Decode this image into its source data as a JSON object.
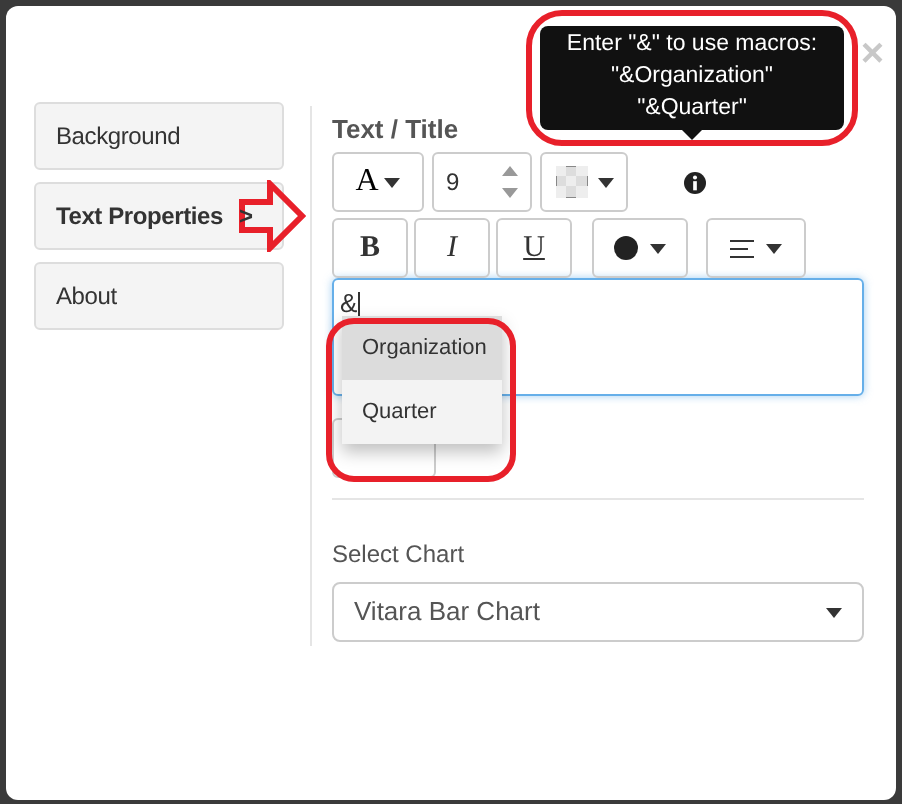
{
  "dialog": {
    "close": "×"
  },
  "sidebar": {
    "items": [
      {
        "label": "Background",
        "selected": false
      },
      {
        "label": "Text Properties",
        "selected": true,
        "marker": ">"
      },
      {
        "label": "About",
        "selected": false
      }
    ]
  },
  "text_title": {
    "label": "Text / Title",
    "font_button": "A",
    "font_size": "9",
    "tooltip": [
      "Enter \"&\" to use macros:",
      "\"&Organization\"",
      "\"&Quarter\""
    ],
    "format_buttons": [
      {
        "label": "B",
        "kind": "bold"
      },
      {
        "label": "I",
        "kind": "italic"
      },
      {
        "label": "U",
        "kind": "underline"
      }
    ],
    "value": "&",
    "suggestions": [
      {
        "label": "Organization",
        "selected": true
      },
      {
        "label": "Quarter",
        "selected": false
      }
    ]
  },
  "select_chart": {
    "label": "Select Chart",
    "value": "Vitara Bar Chart"
  }
}
